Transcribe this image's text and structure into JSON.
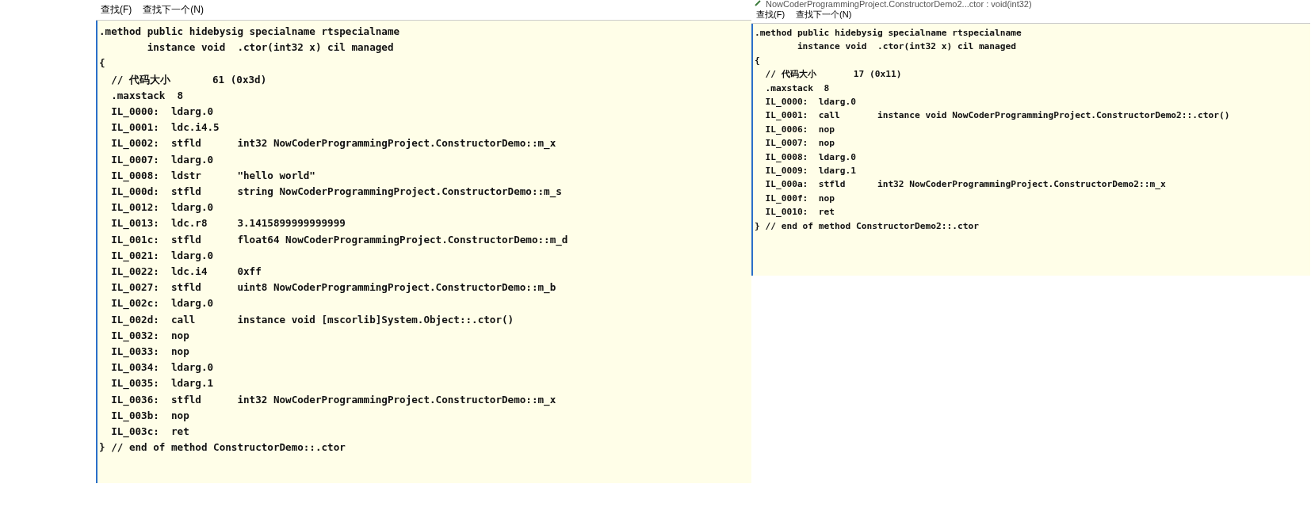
{
  "windows": [
    {
      "menu": [
        "查找(F)",
        "查找下一个(N)"
      ],
      "code_lines": [
        ".method public hidebysig specialname rtspecialname",
        "        instance void  .ctor(int32 x) cil managed",
        "{",
        "  // 代码大小       61 (0x3d)",
        "  .maxstack  8",
        "  IL_0000:  ldarg.0",
        "  IL_0001:  ldc.i4.5",
        "  IL_0002:  stfld      int32 NowCoderProgrammingProject.ConstructorDemo::m_x",
        "  IL_0007:  ldarg.0",
        "  IL_0008:  ldstr      \"hello world\"",
        "  IL_000d:  stfld      string NowCoderProgrammingProject.ConstructorDemo::m_s",
        "  IL_0012:  ldarg.0",
        "  IL_0013:  ldc.r8     3.1415899999999999",
        "  IL_001c:  stfld      float64 NowCoderProgrammingProject.ConstructorDemo::m_d",
        "  IL_0021:  ldarg.0",
        "  IL_0022:  ldc.i4     0xff",
        "  IL_0027:  stfld      uint8 NowCoderProgrammingProject.ConstructorDemo::m_b",
        "  IL_002c:  ldarg.0",
        "  IL_002d:  call       instance void [mscorlib]System.Object::.ctor()",
        "  IL_0032:  nop",
        "  IL_0033:  nop",
        "  IL_0034:  ldarg.0",
        "  IL_0035:  ldarg.1",
        "  IL_0036:  stfld      int32 NowCoderProgrammingProject.ConstructorDemo::m_x",
        "  IL_003b:  nop",
        "  IL_003c:  ret",
        "} // end of method ConstructorDemo::.ctor"
      ]
    },
    {
      "title": "NowCoderProgrammingProject.ConstructorDemo2...ctor : void(int32)",
      "menu": [
        "查找(F)",
        "查找下一个(N)"
      ],
      "code_lines": [
        ".method public hidebysig specialname rtspecialname",
        "        instance void  .ctor(int32 x) cil managed",
        "{",
        "  // 代码大小       17 (0x11)",
        "  .maxstack  8",
        "  IL_0000:  ldarg.0",
        "  IL_0001:  call       instance void NowCoderProgrammingProject.ConstructorDemo2::.ctor()",
        "  IL_0006:  nop",
        "  IL_0007:  nop",
        "  IL_0008:  ldarg.0",
        "  IL_0009:  ldarg.1",
        "  IL_000a:  stfld      int32 NowCoderProgrammingProject.ConstructorDemo2::m_x",
        "  IL_000f:  nop",
        "  IL_0010:  ret",
        "} // end of method ConstructorDemo2::.ctor"
      ]
    }
  ]
}
